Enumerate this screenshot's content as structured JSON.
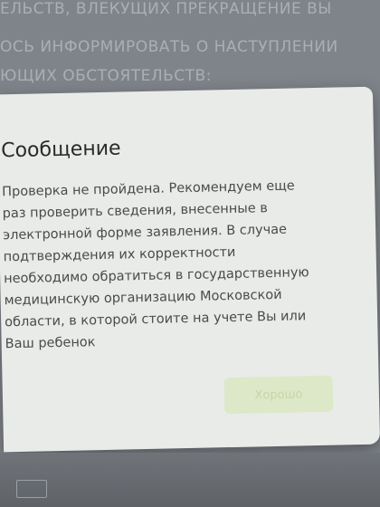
{
  "background": {
    "lines": [
      "ЕЛЬСТВ, ВЛЕКУЩИХ ПРЕКРАЩЕНИЕ ВЫ",
      "ОСЬ ИНФОРМИРОВАТЬ О НАСТУПЛЕНИИ",
      "ЮЩИХ ОБСТОЯТЕЛЬСТВ:"
    ]
  },
  "dialog": {
    "title": "Сообщение",
    "message": "Проверка не пройдена. Рекомендуем еще\nраз проверить сведения, внесенные в\nэлектронной форме заявления. В случае\nподтверждения их корректности\nнеобходимо обратиться в государственную\nмедицинскую организацию Московской\nобласти, в которой стоите на учете Вы или\nВаш ребенок",
    "ok_label": "Хорошо"
  },
  "colors": {
    "dialog_bg": "#e9ebe8",
    "ok_button_bg": "#dde8c8",
    "ok_button_text": "#c5d6a6"
  }
}
